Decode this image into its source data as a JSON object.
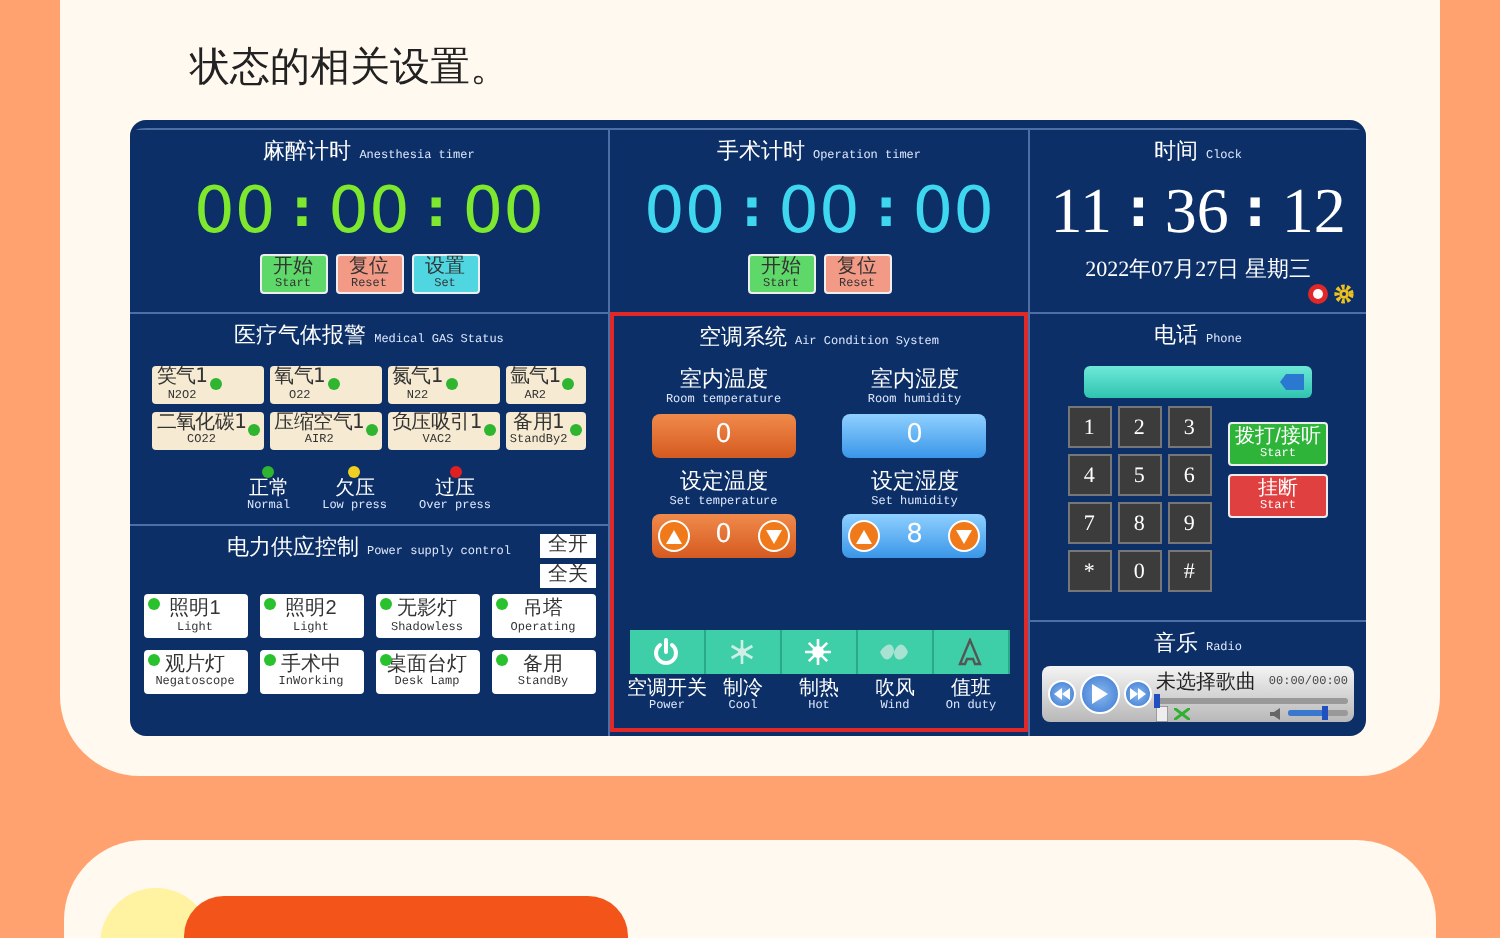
{
  "intro_text": "状态的相关设置。",
  "anesthesia_timer": {
    "title": "麻醉计时",
    "subtitle": "Anesthesia timer",
    "hours": "00",
    "minutes": "00",
    "seconds": "00",
    "separator": ":",
    "buttons": [
      {
        "label": "开始",
        "sublabel": "Start",
        "kind": "start"
      },
      {
        "label": "复位",
        "sublabel": "Reset",
        "kind": "reset"
      },
      {
        "label": "设置",
        "sublabel": "Set",
        "kind": "set"
      }
    ]
  },
  "gas_status": {
    "title": "医疗气体报警",
    "subtitle": "Medical GAS Status",
    "items": [
      {
        "name": "笑气1",
        "code": "N2O2",
        "color": "#2fb52f"
      },
      {
        "name": "氧气1",
        "code": "O22",
        "color": "#2fb52f"
      },
      {
        "name": "氮气1",
        "code": "N22",
        "color": "#2fb52f"
      },
      {
        "name": "氩气1",
        "code": "AR2",
        "color": "#2fb52f"
      },
      {
        "name": "二氧化碳1",
        "code": "CO22",
        "color": "#2fb52f"
      },
      {
        "name": "压缩空气1",
        "code": "AIR2",
        "color": "#2fb52f"
      },
      {
        "name": "负压吸引1",
        "code": "VAC2",
        "color": "#2fb52f"
      },
      {
        "name": "备用1",
        "code": "StandBy2",
        "color": "#2fb52f"
      }
    ],
    "legend": [
      {
        "label": "正常",
        "sublabel": "Normal",
        "color": "#2fb52f"
      },
      {
        "label": "欠压",
        "sublabel": "Low press",
        "color": "#f0d020"
      },
      {
        "label": "过压",
        "sublabel": "Over press",
        "color": "#e02020"
      }
    ]
  },
  "power_supply": {
    "title": "电力供应控制",
    "subtitle": "Power supply control",
    "all_buttons": [
      "全开",
      "全关"
    ],
    "items": [
      {
        "label": "照明1",
        "sublabel": "Light",
        "on": true
      },
      {
        "label": "照明2",
        "sublabel": "Light",
        "on": true
      },
      {
        "label": "无影灯",
        "sublabel": "Shadowless",
        "on": true
      },
      {
        "label": "吊塔",
        "sublabel": "Operating",
        "on": true
      },
      {
        "label": "观片灯",
        "sublabel": "Negatoscope",
        "on": true
      },
      {
        "label": "手术中",
        "sublabel": "InWorking",
        "on": true
      },
      {
        "label": "桌面台灯",
        "sublabel": "Desk Lamp",
        "on": true
      },
      {
        "label": "备用",
        "sublabel": "StandBy",
        "on": true
      }
    ]
  },
  "operation_timer": {
    "title": "手术计时",
    "subtitle": "Operation timer",
    "hours": "00",
    "minutes": "00",
    "seconds": "00",
    "separator": ":",
    "buttons": [
      {
        "label": "开始",
        "sublabel": "Start",
        "kind": "start"
      },
      {
        "label": "复位",
        "sublabel": "Reset",
        "kind": "reset"
      }
    ]
  },
  "air_condition": {
    "title": "空调系统",
    "subtitle": "Air Condition System",
    "readings": [
      {
        "label": "室内温度",
        "sublabel": "Room temperature",
        "value": "0",
        "kind": "temperature"
      },
      {
        "label": "室内湿度",
        "sublabel": "Room humidity",
        "value": "0",
        "kind": "humidity"
      }
    ],
    "setpoints": [
      {
        "label": "设定温度",
        "sublabel": "Set temperature",
        "value": "0",
        "kind": "temperature"
      },
      {
        "label": "设定湿度",
        "sublabel": "Set humidity",
        "value": "8",
        "kind": "humidity"
      }
    ],
    "modes": [
      {
        "label": "空调开关",
        "sublabel": "Power",
        "kind": "power"
      },
      {
        "label": "制冷",
        "sublabel": "Cool",
        "kind": "cool"
      },
      {
        "label": "制热",
        "sublabel": "Hot",
        "kind": "hot"
      },
      {
        "label": "吹风",
        "sublabel": "Wind",
        "kind": "wind"
      },
      {
        "label": "值班",
        "sublabel": "On duty",
        "kind": "duty"
      }
    ]
  },
  "clock": {
    "title": "时间",
    "subtitle": "Clock",
    "hours": "11",
    "minutes": "36",
    "seconds": "12",
    "separator": ":",
    "date": "2022年07月27日  星期三"
  },
  "phone": {
    "title": "电话",
    "subtitle": "Phone",
    "keys": [
      "1",
      "2",
      "3",
      "4",
      "5",
      "6",
      "7",
      "8",
      "9",
      "*",
      "0",
      "#"
    ],
    "call_buttons": [
      {
        "label": "拨打/接听",
        "sublabel": "Start",
        "kind": "dial"
      },
      {
        "label": "挂断",
        "sublabel": "Start",
        "kind": "hangup"
      }
    ]
  },
  "music": {
    "title": "音乐",
    "subtitle": "Radio",
    "song": "未选择歌曲",
    "time": "00:00/00:00",
    "progress": {
      "level": 0
    },
    "volume": {
      "level": 0.6
    }
  }
}
